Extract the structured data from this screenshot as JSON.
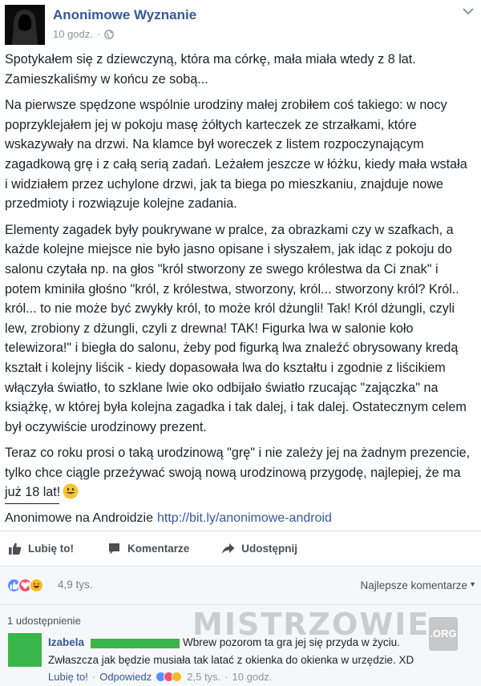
{
  "post": {
    "page_name": "Anonimowe Wyznanie",
    "time": "10 godz.",
    "dot": "·",
    "paragraphs": [
      "Spotykałem się z dziewczyną, która ma córkę, mała miała wtedy z 8 lat. Zamieszkaliśmy w końcu ze sobą...",
      "Na pierwsze spędzone wspólnie urodziny małej zrobiłem coś takiego: w nocy poprzyklejałem jej w pokoju masę żółtych karteczek ze strzałkami, które wskazywały na drzwi. Na klamce był woreczek z listem rozpoczynającym zagadkową grę i z całą serią zadań. Leżałem jeszcze w łóżku, kiedy mała wstała i widziałem przez uchylone drzwi, jak ta biega po mieszkaniu, znajduje nowe przedmioty i rozwiązuje kolejne zadania.",
      "Elementy zagadek były poukrywane w pralce, za obrazkami czy w szafkach, a każde kolejne miejsce nie było jasno opisane i słyszałem, jak idąc z pokoju do salonu czytała np. na głos \"król stworzony ze swego królestwa da Ci znak\" i potem kminiła głośno \"król, z królestwa, stworzony, król... stworzony król? Król.. król... to nie może być zwykły król, to może król dżungli! Tak! Król dżungli, czyli lew, zrobiony z dżungli, czyli z drewna! TAK! Figurka lwa w salonie koło telewizora!\" i biegła do salonu, żeby pod figurką lwa znaleźć obrysowany kredą kształt i kolejny liścik - kiedy dopasowała lwa do kształtu i zgodnie z liścikiem włączyła światło, to szklane lwie oko odbijało światło rzucając \"zajączka\" na książkę, w której była kolejna zagadka i tak dalej, i tak dalej. Ostatecznym celem był oczywiście urodzinowy prezent.",
      "Teraz co roku prosi o taką urodzinową \"grę\" i nie zależy jej na żadnym prezencie, tylko chce ciągle przeżywać swoją nową urodzinową przygodę, najlepiej, że ma już 18 lat!"
    ],
    "footer_text": "Anonimowe na Androidzie",
    "footer_link": "http://bit.ly/anonimowe-android"
  },
  "actions": {
    "like": "Lubię to!",
    "comment": "Komentarze",
    "share": "Udostępnij"
  },
  "reactions": {
    "count": "4,9 tys.",
    "sort_label": "Najlepsze komentarze",
    "types": [
      "like",
      "love",
      "haha"
    ],
    "colors": {
      "like": "#5890ff",
      "love": "#f25268",
      "haha": "#f7b928"
    }
  },
  "shares": {
    "label": "1 udostępnienie"
  },
  "comment": {
    "author": "Izabela",
    "text_line1": "Wbrew pozorom ta gra jej się przyda w życiu.",
    "text_line2": "Zwłaszcza jak będzie musiała tak latać z okienka do okienka w urzędzie. XD",
    "like": "Lubię to!",
    "reply": "Odpowiedz",
    "reaction_count": "2,5 tys.",
    "time": "10 godz.",
    "sep": "·"
  },
  "watermark": {
    "text": "MISTRZOWIE",
    "tld": ".ORG"
  }
}
